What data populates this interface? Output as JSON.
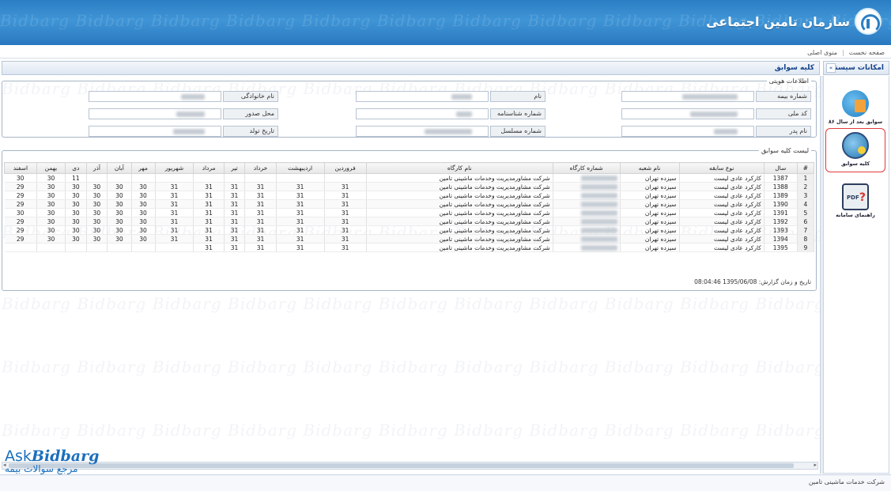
{
  "header": {
    "org_name": "سازمان تامین اجتماعی",
    "watermark": "Bidbarg Bidbarg Bidbarg Bidbarg Bidbarg Bidbarg Bidbarg Bidbarg Bidbarg Bidbarg Bidbarg Bidbarg"
  },
  "menu": {
    "home": "صفحه نخست",
    "main_menu": "منوی اصلی"
  },
  "sidebar": {
    "title": "امکانات سیستم",
    "collapse_icon": "double-chevron",
    "items": [
      {
        "label": "سوابق بعد از سال ۸۶",
        "icon": "history-icon"
      },
      {
        "label": "کلیه سوابق",
        "icon": "all-records-icon"
      },
      {
        "label": "راهنمای سامانه",
        "icon": "pdf-help-icon"
      }
    ]
  },
  "main": {
    "title": "کلیه سوابق",
    "identity": {
      "legend": "اطلاعات هویتی",
      "fields": {
        "insurance_no": "شماره بیمه",
        "name": "نام",
        "family_name": "نام خانوادگی",
        "national_code": "کد ملی",
        "id_no": "شماره شناسنامه",
        "issue_place": "محل صدور",
        "father_name": "نام پدر",
        "serial_no": "شماره مسلسل",
        "birth_date": "تاریخ تولد"
      }
    },
    "records": {
      "legend": "لیست کلیه سوابق",
      "columns": [
        "#",
        "سال",
        "نوع سابقه",
        "نام شعبه",
        "شماره کارگاه",
        "نام کارگاه",
        "فروردین",
        "اردیبهشت",
        "خرداد",
        "تیر",
        "مرداد",
        "شهریور",
        "مهر",
        "آبان",
        "آذر",
        "دی",
        "بهمن",
        "اسفند"
      ],
      "rows": [
        {
          "n": "1",
          "year": "1387",
          "type": "کارکرد عادی لیست",
          "branch": "سیزده تهران",
          "workshop": "شرکت مشاورمدیریت وخدمات ماشینی تامین",
          "months": [
            "",
            "",
            "",
            "",
            "",
            "",
            "",
            "",
            "",
            "11",
            "30",
            "30"
          ]
        },
        {
          "n": "2",
          "year": "1388",
          "type": "کارکرد عادی لیست",
          "branch": "سیزده تهران",
          "workshop": "شرکت مشاورمدیریت وخدمات ماشینی تامین",
          "months": [
            "31",
            "31",
            "31",
            "31",
            "31",
            "31",
            "30",
            "30",
            "30",
            "30",
            "30",
            "29"
          ]
        },
        {
          "n": "3",
          "year": "1389",
          "type": "کارکرد عادی لیست",
          "branch": "سیزده تهران",
          "workshop": "شرکت مشاورمدیریت وخدمات ماشینی تامین",
          "months": [
            "31",
            "31",
            "31",
            "31",
            "31",
            "31",
            "30",
            "30",
            "30",
            "30",
            "30",
            "29"
          ]
        },
        {
          "n": "4",
          "year": "1390",
          "type": "کارکرد عادی لیست",
          "branch": "سیزده تهران",
          "workshop": "شرکت مشاورمدیریت وخدمات ماشینی تامین",
          "months": [
            "31",
            "31",
            "31",
            "31",
            "31",
            "31",
            "30",
            "30",
            "30",
            "30",
            "30",
            "29"
          ]
        },
        {
          "n": "5",
          "year": "1391",
          "type": "کارکرد عادی لیست",
          "branch": "سیزده تهران",
          "workshop": "شرکت مشاورمدیریت وخدمات ماشینی تامین",
          "months": [
            "31",
            "31",
            "31",
            "31",
            "31",
            "31",
            "30",
            "30",
            "30",
            "30",
            "30",
            "30"
          ]
        },
        {
          "n": "6",
          "year": "1392",
          "type": "کارکرد عادی لیست",
          "branch": "سیزده تهران",
          "workshop": "شرکت مشاورمدیریت وخدمات ماشینی تامین",
          "months": [
            "31",
            "31",
            "31",
            "31",
            "31",
            "31",
            "30",
            "30",
            "30",
            "30",
            "30",
            "29"
          ]
        },
        {
          "n": "7",
          "year": "1393",
          "type": "کارکرد عادی لیست",
          "branch": "سیزده تهران",
          "workshop": "شرکت مشاورمدیریت وخدمات ماشینی تامین",
          "months": [
            "31",
            "31",
            "31",
            "31",
            "31",
            "31",
            "30",
            "30",
            "30",
            "30",
            "30",
            "29"
          ]
        },
        {
          "n": "8",
          "year": "1394",
          "type": "کارکرد عادی لیست",
          "branch": "سیزده تهران",
          "workshop": "شرکت مشاورمدیریت وخدمات ماشینی تامین",
          "months": [
            "31",
            "31",
            "31",
            "31",
            "31",
            "31",
            "30",
            "30",
            "30",
            "30",
            "30",
            "29"
          ]
        },
        {
          "n": "9",
          "year": "1395",
          "type": "کارکرد عادی لیست",
          "branch": "سیزده تهران",
          "workshop": "شرکت مشاورمدیریت وخدمات ماشینی تامین",
          "months": [
            "31",
            "31",
            "31",
            "31",
            "31",
            "",
            "",
            "",
            "",
            "",
            "",
            ""
          ]
        }
      ],
      "report_time": "تاریخ و زمان گزارش: 1395/06/08 08:04:46"
    }
  },
  "status": {
    "text": "شرکت خدمات ماشینی تامین"
  },
  "overlay": {
    "brand_en": "Ask",
    "brand_en2": "Bidbarg",
    "brand_fa": "مرجع سوالات بیمه"
  }
}
